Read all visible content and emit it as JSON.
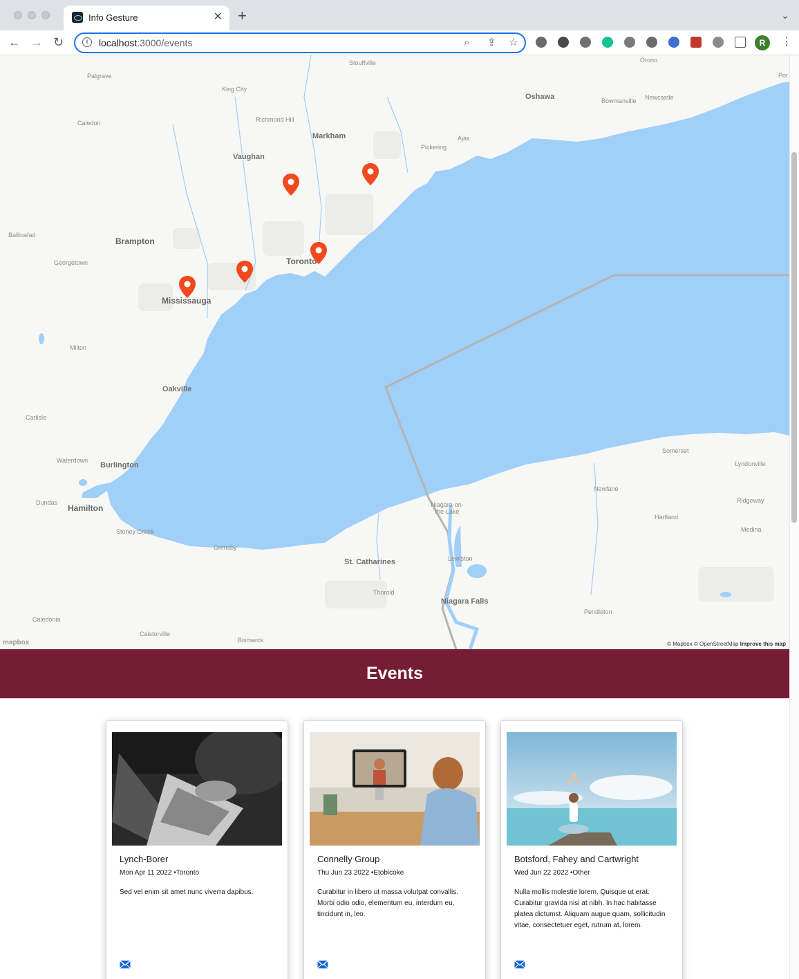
{
  "browser": {
    "tab_title": "Info Gesture",
    "url_host": "localhost",
    "url_rest": ":3000/events",
    "profile_initial": "R"
  },
  "map": {
    "places": {
      "stouffville": "Stouffville",
      "orono": "Orono",
      "palgrave": "Palgrave",
      "king_city": "King City",
      "oshawa": "Oshawa",
      "bowmanville": "Bowmanville",
      "newcastle": "Newcastle",
      "caledon": "Caledon",
      "richmond_hill": "Richmond Hill",
      "markham": "Markham",
      "ajax": "Ajax",
      "pickering": "Pickering",
      "vaughan": "Vaughan",
      "ballinafad": "Ballinafad",
      "brampton": "Brampton",
      "georgetown": "Georgetown",
      "toronto": "Toronto",
      "mississauga": "Mississauga",
      "milton": "Milton",
      "oakville": "Oakville",
      "carlisle": "Carlisle",
      "waterdown": "Waterdown",
      "burlington": "Burlington",
      "somerset": "Somerset",
      "lyndonville": "Lyndonville",
      "newfane": "Newfane",
      "ridgeway": "Ridgeway",
      "dundas": "Dundas",
      "hamilton": "Hamilton",
      "niagara_on_the_lake": "Niagara-on-the-Lake",
      "hartland": "Hartland",
      "medina": "Medina",
      "stoney_creek": "Stoney Creek",
      "grimsby": "Grimsby",
      "lewiston": "Lewiston",
      "st_catharines": "St. Catharines",
      "thorold": "Thorold",
      "niagara_falls": "Niagara Falls",
      "pendleton": "Pendleton",
      "caledonia": "Caledonia",
      "caistorville": "Caistorville",
      "bismarck": "Bismarck",
      "por": "Por"
    },
    "logo": "mapbox",
    "attribution": "© Mapbox © OpenStreetMap",
    "improve": "Improve this map",
    "colors": {
      "water": "#a0cff8",
      "land": "#f7f7f5",
      "pin": "#f0491e",
      "border": "#b4b4b4"
    }
  },
  "events": {
    "title": "Events",
    "header_color": "#751d34",
    "cards": [
      {
        "title": "Lynch-Borer",
        "date": "Mon Apr 11 2022",
        "location": "•Toronto",
        "description": "Sed vel enim sit amet nunc viverra dapibus."
      },
      {
        "title": "Connelly Group",
        "date": "Thu Jun 23 2022",
        "location": "•Etobicoke",
        "description": "Curabitur in libero ut massa volutpat convallis. Morbi odio odio, elementum eu, interdum eu, tincidunt in, leo."
      },
      {
        "title": "Botsford, Fahey and Cartwright",
        "date": "Wed Jun 22 2022",
        "location": "•Other",
        "description": "Nulla mollis molestie lorem. Quisque ut erat. Curabitur gravida nisi at nibh. In hac habitasse platea dictumst. Aliquam augue quam, sollicitudin vitae, consectetuer eget, rutrum at, lorem."
      }
    ]
  }
}
